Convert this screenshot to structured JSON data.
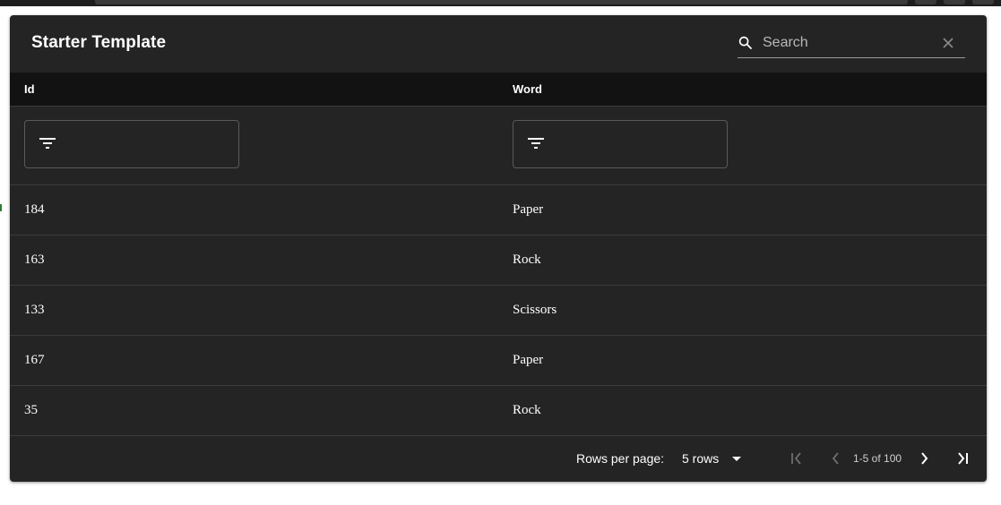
{
  "window": {
    "title": "Starter Template"
  },
  "search": {
    "placeholder": "Search",
    "value": ""
  },
  "table": {
    "columns": [
      "Id",
      "Word"
    ],
    "filters": [
      "",
      ""
    ],
    "rows": [
      {
        "id": "184",
        "word": "Paper"
      },
      {
        "id": "163",
        "word": "Rock"
      },
      {
        "id": "133",
        "word": "Scissors"
      },
      {
        "id": "167",
        "word": "Paper"
      },
      {
        "id": "35",
        "word": "Rock"
      }
    ]
  },
  "pagination": {
    "rows_per_page_label": "Rows per page:",
    "rows_per_page_value": "5 rows",
    "range_text": "1-5 of 100"
  },
  "icons": {
    "search": "search-icon",
    "clear": "close-icon",
    "filter": "filter-list-icon",
    "dropdown": "arrow-drop-down-icon",
    "first": "first-page-icon",
    "prev": "chevron-left-icon",
    "next": "chevron-right-icon",
    "last": "last-page-icon"
  },
  "colors": {
    "panel_bg": "#242424",
    "header_bg": "#121212",
    "text": "#ffffff",
    "disabled": "#6e6e6e"
  }
}
